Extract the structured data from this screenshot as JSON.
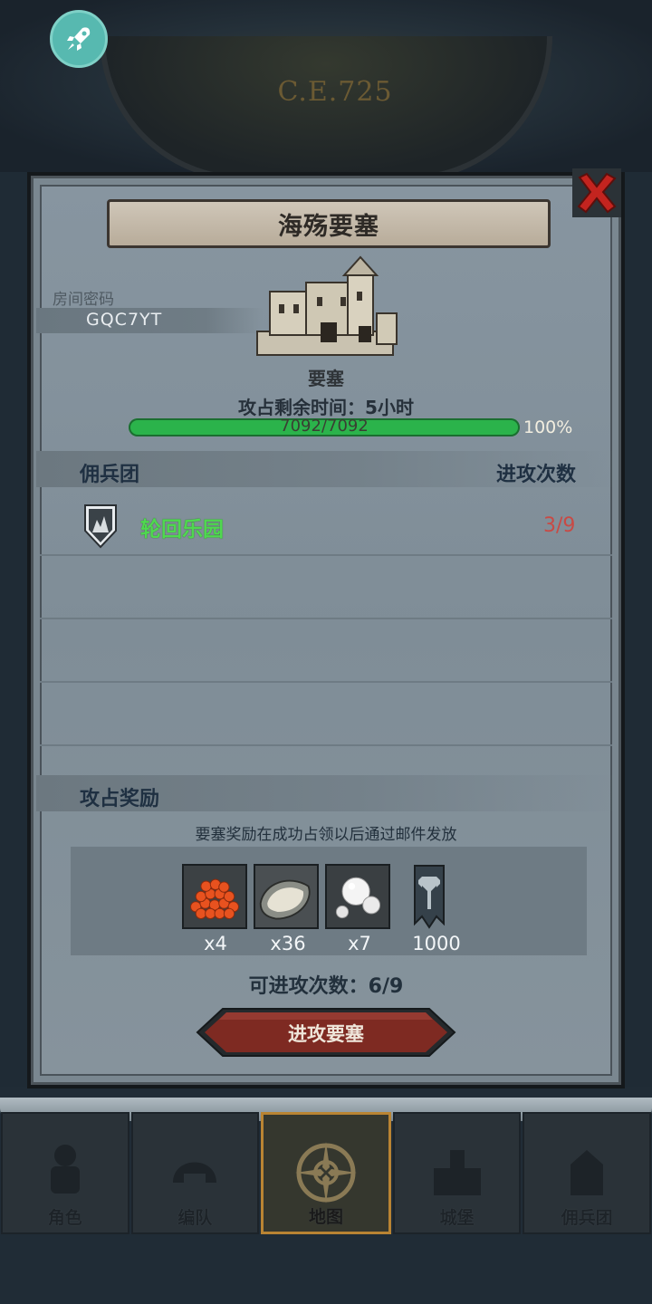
{
  "header": {
    "era_label": "C.E.725",
    "rocket_icon": "rocket-icon"
  },
  "dialog": {
    "title": "海殇要塞",
    "room": {
      "label": "房间密码",
      "code": "GQC7YT"
    },
    "fortress": {
      "type_label": "要塞",
      "time_label": "攻占剩余时间：5小时"
    },
    "hp": {
      "current": 7092,
      "max": 7092,
      "text": "7092/7092",
      "percent_text": "100%",
      "fraction": 1.0
    },
    "mercenaries": {
      "column_left": "佣兵团",
      "column_right": "进攻次数",
      "rows": [
        {
          "name": "轮回乐园",
          "attacks": "3/9",
          "name_color": "#4fd84f",
          "count_color": "#c84a45"
        }
      ]
    },
    "rewards": {
      "title": "攻占奖励",
      "note": "要塞奖励在成功占领以后通过邮件发放",
      "items": [
        {
          "icon": "roe-icon",
          "qty": "x4"
        },
        {
          "icon": "oyster-icon",
          "qty": "x36"
        },
        {
          "icon": "pearl-icon",
          "qty": "x7"
        },
        {
          "icon": "banner-icon",
          "qty": "1000"
        }
      ]
    },
    "attack_count": "可进攻次数：6/9",
    "attack_button": "进攻要塞"
  },
  "nav": {
    "tabs": [
      {
        "label": "角色",
        "icon": "knight-icon"
      },
      {
        "label": "编队",
        "icon": "helmet-icon"
      },
      {
        "label": "地图",
        "icon": "compass-icon",
        "active": true
      },
      {
        "label": "城堡",
        "icon": "castle-icon"
      },
      {
        "label": "佣兵团",
        "icon": "mercenary-icon"
      }
    ]
  }
}
